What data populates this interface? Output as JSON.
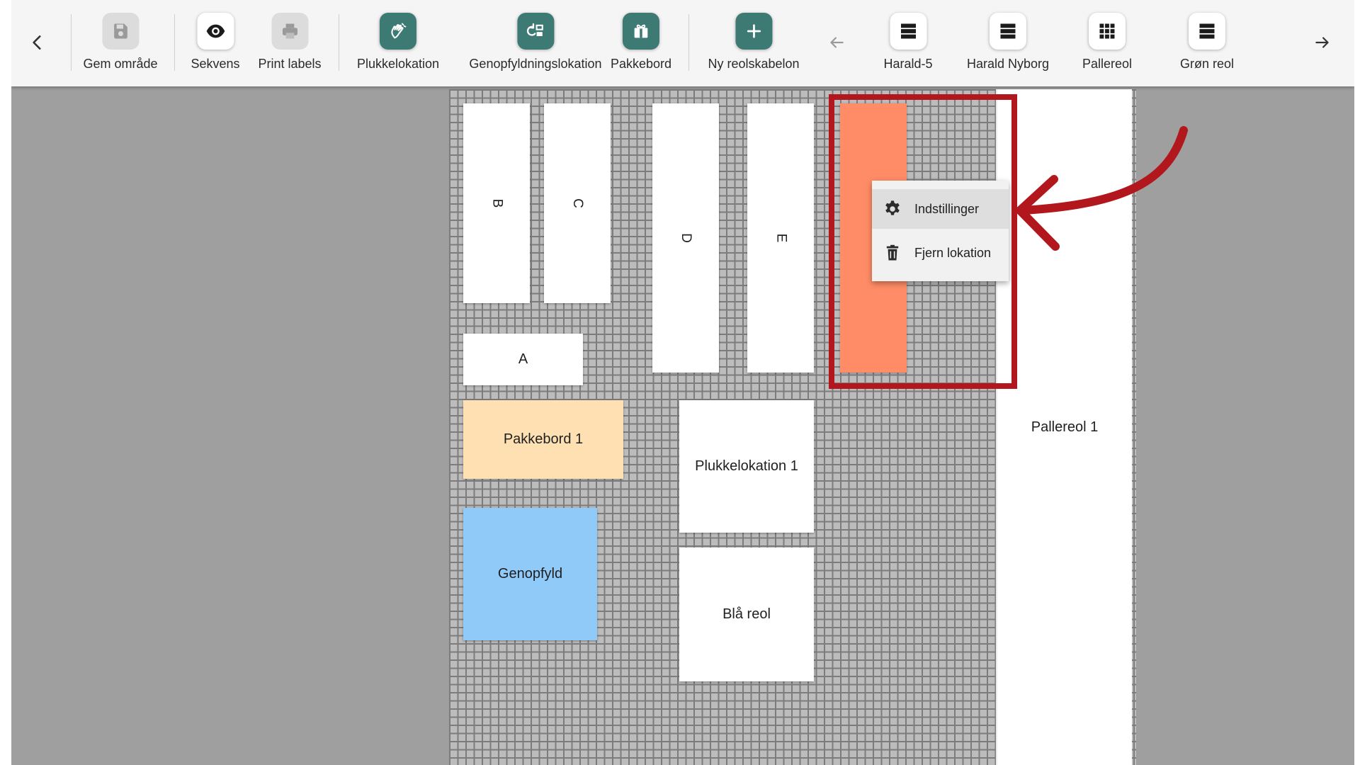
{
  "toolbar": {
    "items": [
      {
        "label": "Gem område",
        "icon": "save-icon"
      },
      {
        "label": "Sekvens",
        "icon": "eye-icon"
      },
      {
        "label": "Print labels",
        "icon": "printer-icon"
      },
      {
        "label": "Plukkelokation",
        "icon": "hand-icon"
      },
      {
        "label": "Genopfyldningslokation",
        "icon": "refill-icon"
      },
      {
        "label": "Pakkebord",
        "icon": "package-icon"
      },
      {
        "label": "Ny reolskabelon",
        "icon": "plus-icon"
      },
      {
        "label": "Harald-5",
        "icon": "shelf-rows-icon"
      },
      {
        "label": "Harald Nyborg",
        "icon": "shelf-rows-icon"
      },
      {
        "label": "Pallereol",
        "icon": "grid-icon"
      },
      {
        "label": "Grøn reol",
        "icon": "shelf-rows-icon"
      }
    ]
  },
  "locations": {
    "b": "B",
    "c": "C",
    "d": "D",
    "e": "E",
    "a": "A",
    "pakkebord": "Pakkebord 1",
    "plukkelokation": "Plukkelokation 1",
    "genopfyld": "Genopfyld",
    "blaa_reol": "Blå reol",
    "pallereol": "Pallereol 1"
  },
  "context_menu": {
    "items": [
      {
        "label": "Indstillinger",
        "icon": "gear-icon"
      },
      {
        "label": "Fjern lokation",
        "icon": "trash-icon"
      }
    ]
  },
  "colors": {
    "teal_button": "#3e7a74",
    "selected_location": "#ff8c66",
    "pakkebord": "#ffe0b2",
    "genopfyld": "#90caf9",
    "annotation_red": "#b2171d"
  }
}
